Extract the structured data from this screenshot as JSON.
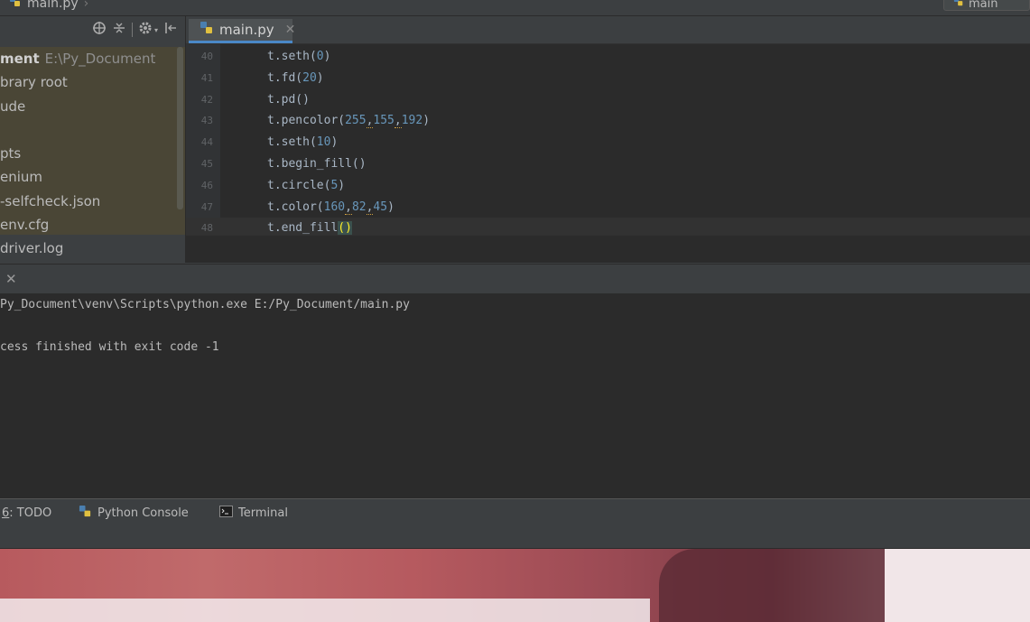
{
  "topbar": {
    "breadcrumb_file": "main.py",
    "breadcrumb_sep": "›",
    "run_config": "main"
  },
  "project": {
    "items": [
      {
        "name": "ment",
        "path": "E:\\Py_Document"
      },
      {
        "name": "brary root"
      },
      {
        "name": "ude"
      },
      {
        "name": ""
      },
      {
        "name": "pts"
      },
      {
        "name": "enium"
      },
      {
        "name": "-selfcheck.json"
      },
      {
        "name": "env.cfg"
      },
      {
        "name": "driver.log"
      }
    ]
  },
  "editor": {
    "tab_label": "main.py",
    "lines": [
      {
        "num": "40",
        "pre": "t.seth(",
        "args": [
          "0"
        ],
        "post": ")"
      },
      {
        "num": "41",
        "pre": "t.fd(",
        "args": [
          "20"
        ],
        "post": ")"
      },
      {
        "num": "42",
        "pre": "t.pd()",
        "args": [],
        "post": ""
      },
      {
        "num": "43",
        "pre": "t.pencolor(",
        "args": [
          "255",
          "155",
          "192"
        ],
        "post": ")"
      },
      {
        "num": "44",
        "pre": "t.seth(",
        "args": [
          "10"
        ],
        "post": ")"
      },
      {
        "num": "45",
        "pre": "t.begin_fill()",
        "args": [],
        "post": ""
      },
      {
        "num": "46",
        "pre": "t.circle(",
        "args": [
          "5"
        ],
        "post": ")"
      },
      {
        "num": "47",
        "pre": "t.color(",
        "args": [
          "160",
          "82",
          "45"
        ],
        "post": ")"
      },
      {
        "num": "48",
        "pre": "t.end_fill",
        "args": [],
        "post": "",
        "brace": "()"
      }
    ]
  },
  "console": {
    "line1": "Py_Document\\venv\\Scripts\\python.exe E:/Py_Document/main.py",
    "line2": "cess finished with exit code -1"
  },
  "toolbar": {
    "todo_num": "6",
    "todo_label": ": TODO",
    "python_console": "Python Console",
    "terminal": "Terminal"
  },
  "colors": {
    "accent": "#4a88c7",
    "number": "#6897bb",
    "code": "#a9b7c6"
  }
}
